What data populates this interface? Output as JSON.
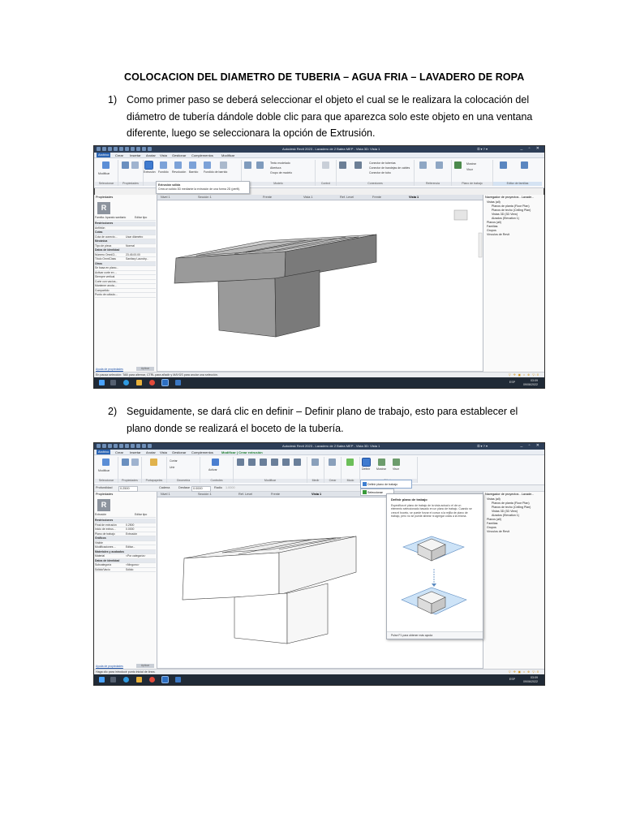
{
  "document": {
    "title": "COLOCACION DEL DIAMETRO DE TUBERIA – AGUA FRIA – LAVADERO DE ROPA",
    "steps": [
      {
        "number": "1)",
        "text": "Como primer paso se deberá seleccionar el objeto el cual se le realizara la colocación del diámetro de tubería dándole doble clic para que aparezca solo este objeto en una ventana diferente, luego se seleccionara la opción de Extrusión."
      },
      {
        "number": "2)",
        "text": "Seguidamente, se dará clic en definir – Definir plano de trabajo, esto para establecer el plano donde se realizará el boceto de la tubería."
      }
    ]
  },
  "screenshot1": {
    "window_title": "Autodesk Revit 2023 - Lavadero de 2 Batea MEP - Vista 3D: Vista 1",
    "menu_items": [
      "Archivo",
      "Crear",
      "Insertar",
      "Anotar",
      "Vista",
      "Gestionar",
      "Complementos",
      "Modificar"
    ],
    "ribbon_groups": [
      "Seleccionar",
      "Propiedades",
      "Forma",
      "Modelo",
      "Control",
      "Conexiones",
      "Referencia",
      "Plano de trabajo",
      "Editor de familias"
    ],
    "ribbon_labels": [
      "Modificar",
      "Extrusión",
      "Fundido",
      "Revolución",
      "Barrido",
      "Fundido de barrido",
      "Formas vacías",
      "Línea de modelo",
      "Componente",
      "Texto modelado",
      "Abertura",
      "Grupo de modelo",
      "Control",
      "Conector eléctrico",
      "Conector de conducto",
      "Conector de tuberías",
      "Conector de bandejas de cables",
      "Conector de tubo",
      "Línea de referencia",
      "Plano de referencia",
      "Definir",
      "Mostrar",
      "Visor",
      "Cargar en proyecto",
      "Cargar en proyecto y cerrar"
    ],
    "tooltip_title": "Extrusión sólida",
    "tooltip_text": "Crea un sólido 3D mediante la extrusión de una forma 2D (perfil).",
    "tooltip_f1": "Pulse F1 para obtener más ayuda",
    "tooltip_extra": "El sólido se está congelando...",
    "view_tabs": [
      "Nivel 1",
      "Sección 1",
      "Frente",
      "Vista 1",
      "Ref. Level",
      "Frente",
      "Vista 1"
    ],
    "properties_header": "Propiedades",
    "properties_family": "Familia: Aparato sanitario",
    "properties_edit_type": "Editar tipo",
    "properties_rows": [
      {
        "label": "Restricciones",
        "section": true
      },
      {
        "label": "Anfitrión",
        "value": ""
      },
      {
        "label": "Cotas",
        "section": true
      },
      {
        "label": "Cota de conecto...",
        "value": "Usar diámetro"
      },
      {
        "label": "Mecánica",
        "section": true
      },
      {
        "label": "Tipo de pieza",
        "value": "Normal"
      },
      {
        "label": "Datos de identidad",
        "section": true
      },
      {
        "label": "Número OmniCl...",
        "value": "23.45.00.00"
      },
      {
        "label": "Título OmniClass",
        "value": "Sanitary Laundry..."
      },
      {
        "label": "Otros",
        "section": true
      },
      {
        "label": "Se basa en plano...",
        "value": ""
      },
      {
        "label": "Activar corte en ...",
        "value": ""
      },
      {
        "label": "Siempre vertical",
        "value": ""
      },
      {
        "label": "Corte con vacíos...",
        "value": ""
      },
      {
        "label": "Mantener anota...",
        "value": ""
      },
      {
        "label": "Compartido",
        "value": ""
      },
      {
        "label": "Punto de cálculo...",
        "value": ""
      }
    ],
    "properties_help": "Ayuda de propiedades",
    "properties_apply": "Aplicar",
    "browser_header": "Navegador de proyectos - Lavade...",
    "browser_nodes": [
      "Vistas (all)",
      "Planos de planta (Floor Plan)",
      "Planos de techo (Ceiling Plan)",
      "Vistas 3D (3D View)",
      "Alzados (Elevation 1)",
      "Planos (all)",
      "Familias",
      "Grupos",
      "Vínculos de Revit"
    ],
    "scale": "1 : 20",
    "status_text": "En pausa selección: TAB para alternar, CTRL para añadir y MAYÚS para anular una selección.",
    "lang": "ESP",
    "time": "03:09",
    "date": "09/06/2022"
  },
  "screenshot2": {
    "window_title": "Autodesk Revit 2023 - Lavadero de 2 Batea MEP - Vista 3D: Vista 1",
    "menu_items": [
      "Archivo",
      "Crear",
      "Insertar",
      "Anotar",
      "Vista",
      "Gestionar",
      "Complementos",
      "Modificar | Crear extrusión"
    ],
    "ribbon_groups": [
      "Seleccionar",
      "Propiedades",
      "Portapapeles",
      "Geometría",
      "Controles",
      "Modificar",
      "Medir",
      "Crear",
      "Modo",
      "Dibujar"
    ],
    "ribbon_labels": [
      "Modificar",
      "Cortar",
      "Unir",
      "Activar",
      "Definir",
      "Mostrar",
      "Visor"
    ],
    "optbar_depth_label": "Profundidad",
    "optbar_depth_value": "0.2500",
    "optbar_chain": "Cadena",
    "optbar_offset_label": "Desfase",
    "optbar_offset_value": "0.0000",
    "optbar_radius_label": "Radio",
    "optbar_radius_value": "1.0000",
    "dropdown_item": "Definir plano de trabajo",
    "dropdown_select": "Seleccionar",
    "help_title": "Definir plano de trabajo",
    "help_body": "Especifica el plano de trabajo de la vista actual o el de un elemento seleccionado basado en un plano de trabajo. Cuando se crea el boceto, se puede forzar el cursor a la rejilla de plano de trabajo, pero no se puede alinear ni agregar cotas a la misma.",
    "help_foot": "Pulse F1 para obtener más ayuda",
    "view_tabs": [
      "Nivel 1",
      "Sección 1",
      "Ref. Level",
      "Frente",
      "Vista 1"
    ],
    "properties_header": "Propiedades",
    "properties_family": "Extrusión",
    "properties_edit_type": "Editar tipo",
    "properties_rows": [
      {
        "label": "Restricciones",
        "section": true
      },
      {
        "label": "Final de extrusión",
        "value": "0.2500"
      },
      {
        "label": "Inicio de extrus...",
        "value": "0.0000"
      },
      {
        "label": "Plano de trabajo",
        "value": "Extrusión"
      },
      {
        "label": "Gráficos",
        "section": true
      },
      {
        "label": "Visible",
        "value": ""
      },
      {
        "label": "Modificaciones ...",
        "value": "Editar..."
      },
      {
        "label": "Materiales y acabados",
        "section": true
      },
      {
        "label": "Material",
        "value": "<Por categoría>"
      },
      {
        "label": "Datos de identidad",
        "section": true
      },
      {
        "label": "Subcategoría",
        "value": "<Ninguno>"
      },
      {
        "label": "Sólido/Vacío",
        "value": "Sólido"
      }
    ],
    "properties_help": "Ayuda de propiedades",
    "properties_apply": "Aplicar",
    "browser_header": "Navegador de proyectos - Lavade...",
    "browser_nodes": [
      "Vistas (all)",
      "Planos de planta (Floor Plan)",
      "Planos de techo (Ceiling Plan)",
      "Vistas 3D (3D View)",
      "Alzados (Elevation 1)",
      "Planos (all)",
      "Familias",
      "Grupos",
      "Vínculos de Revit"
    ],
    "scale": "1 : 20",
    "status_text": "Haga clic para introducir punto inicial de línea.",
    "lang": "ESP",
    "time": "03:09",
    "date": "09/06/2022"
  },
  "colors": {
    "revit_titlebar": "#2d3e57",
    "model_face_top": "#cfcfcf",
    "model_face_front": "#9a9a9a",
    "model_face_side": "#7a7a7a",
    "taskbar": "#202a36"
  }
}
